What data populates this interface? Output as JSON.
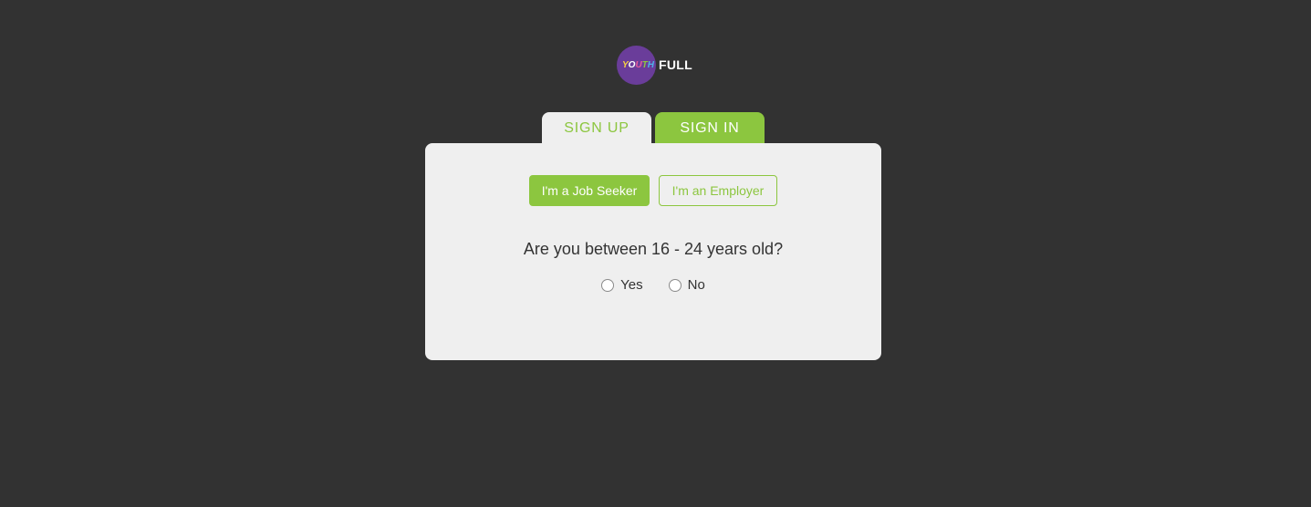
{
  "logo": {
    "mark_letters": [
      "Y",
      "O",
      "U",
      "T",
      "H"
    ],
    "wordmark": "FULL"
  },
  "tabs": {
    "signup_label": "SIGN UP",
    "signin_label": "SIGN IN"
  },
  "roles": {
    "job_seeker_label": "I'm a Job Seeker",
    "employer_label": "I'm an Employer"
  },
  "age_question": {
    "text": "Are you between 16 - 24 years old?",
    "options": [
      {
        "label": "Yes",
        "selected": false
      },
      {
        "label": "No",
        "selected": false
      }
    ]
  },
  "colors": {
    "accent": "#8cc63f",
    "background": "#323232",
    "card": "#efefef",
    "logo_circle": "#6a3d9a"
  }
}
